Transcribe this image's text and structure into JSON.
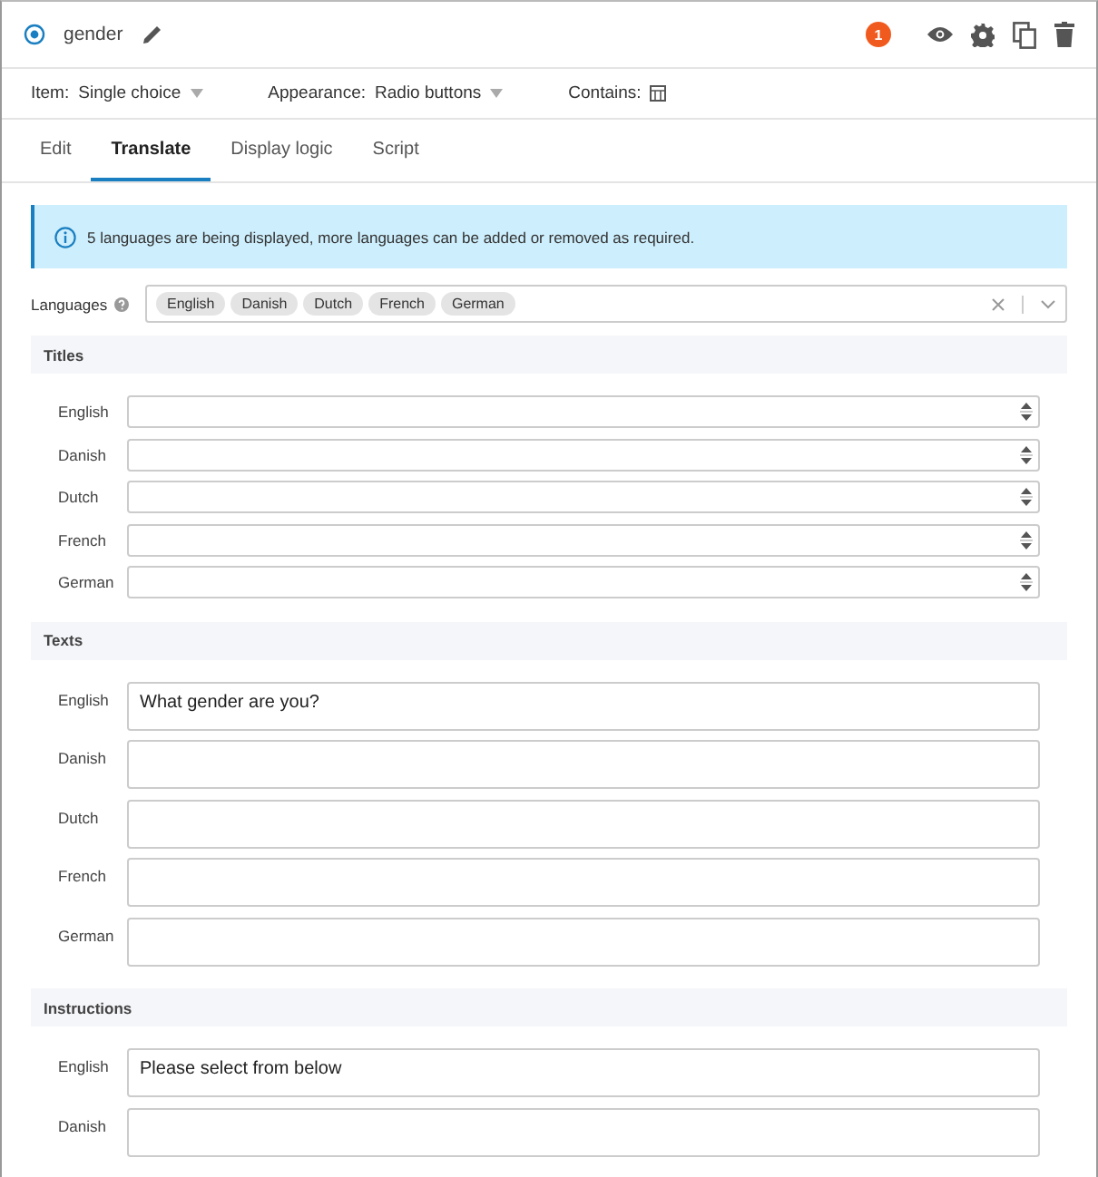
{
  "header": {
    "item_name": "gender",
    "badge": "1"
  },
  "properties": [
    {
      "label": "Item:",
      "value": "Single choice",
      "kind": "dropdown"
    },
    {
      "label": "Appearance:",
      "value": "Radio buttons",
      "kind": "dropdown"
    },
    {
      "label": "Contains:",
      "kind": "icon"
    }
  ],
  "tabs": [
    {
      "label": "Edit",
      "selected": false
    },
    {
      "label": "Translate",
      "selected": true
    },
    {
      "label": "Display logic",
      "selected": false
    },
    {
      "label": "Script",
      "selected": false
    }
  ],
  "info": "5 languages are being displayed, more languages can be added or removed as required.",
  "languages": {
    "label": "Languages",
    "tags": [
      "English",
      "Danish",
      "Dutch",
      "French",
      "German"
    ]
  },
  "sections": [
    {
      "title": "Titles",
      "kind": "spinner",
      "rows": [
        {
          "language": "English"
        },
        {
          "language": "Danish"
        },
        {
          "language": "Dutch"
        },
        {
          "language": "French"
        },
        {
          "language": "German"
        }
      ]
    },
    {
      "title": "Texts",
      "kind": "area",
      "rows": [
        {
          "language": "English",
          "value": "What gender are you?"
        },
        {
          "language": "Danish"
        },
        {
          "language": "Dutch"
        },
        {
          "language": "French"
        },
        {
          "language": "German"
        }
      ]
    },
    {
      "title": "Instructions",
      "kind": "area",
      "rows": [
        {
          "language": "English",
          "value": "Please select from below"
        },
        {
          "language": "Danish"
        }
      ]
    }
  ]
}
